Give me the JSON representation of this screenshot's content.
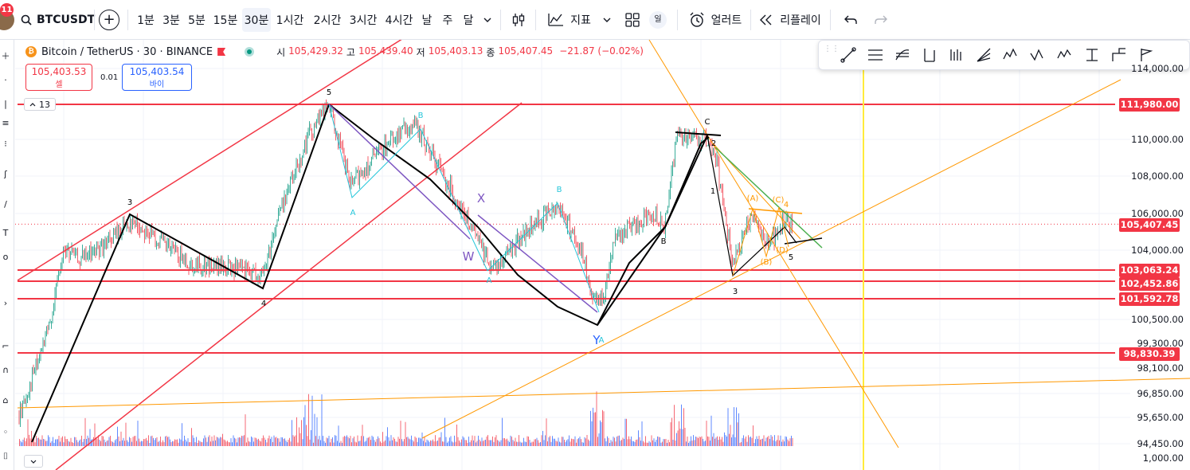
{
  "topbar": {
    "notification_count": "11",
    "symbol": "BTCUSDT",
    "intervals": [
      "1분",
      "3분",
      "5분",
      "15분",
      "30분",
      "1시간",
      "2시간",
      "3시간",
      "4시간",
      "날",
      "주",
      "달"
    ],
    "active_interval": "30분",
    "indicators_label": "지표",
    "layout_badge": "일",
    "alert_label": "얼러트",
    "replay_label": "리플레이"
  },
  "legend": {
    "title": "Bitcoin / TetherUS · 30 · BINANCE",
    "logo_letter": "₿",
    "open_key": "시",
    "open": "105,429.32",
    "high_key": "고",
    "high": "105,439.40",
    "low_key": "저",
    "low": "105,403.13",
    "close_key": "종",
    "close": "105,407.45",
    "change": "−21.87 (−0.02%)"
  },
  "trade": {
    "sell_price": "105,403.53",
    "sell_label": "셀",
    "spread": "0.01",
    "buy_price": "105,403.54",
    "buy_label": "바이"
  },
  "indicator_collapse_count": "13",
  "price_scale": {
    "ticks": [
      "114,000.00",
      "110,000.00",
      "108,000.00",
      "106,000.00",
      "104,000.00",
      "100,500.00",
      "99,300.00",
      "98,100.00",
      "96,850.00",
      "95,650.00",
      "94,450.00",
      "1,000.00"
    ],
    "tags": [
      "111,980.00",
      "105,407.45",
      "103,063.24",
      "102,452.86",
      "101,592.78",
      "98,830.39"
    ]
  },
  "wave_labels": {
    "black": [
      "3",
      "4",
      "5",
      "B",
      "C",
      "1",
      "2",
      "3",
      "4",
      "5"
    ],
    "teal": [
      "A",
      "B",
      "A",
      "B",
      "A"
    ],
    "purple": [
      "X",
      "W",
      "Y"
    ],
    "orange": [
      "(A)",
      "(B)",
      "(C)",
      "(D)"
    ]
  },
  "colors": {
    "up": "#089981",
    "down": "#f23645",
    "hline": "#f23645",
    "channel": "#f23645",
    "fib": "#ff9800",
    "vline": "#ffeb3b",
    "green_line": "#4caf50",
    "wave_black": "#000000",
    "wave_teal": "#26c6da",
    "wave_purple": "#7e57c2"
  },
  "drawbar_tools": [
    "trend-line-icon",
    "parallel-channel-icon",
    "fib-retracement-icon",
    "pitchfork-icon",
    "long-short-icon",
    "fan-icon",
    "elliott-impulse-icon",
    "elliott-correction-icon",
    "elliott-triangle-icon",
    "measure-icon",
    "projection-icon",
    "flag-tool-icon"
  ]
}
